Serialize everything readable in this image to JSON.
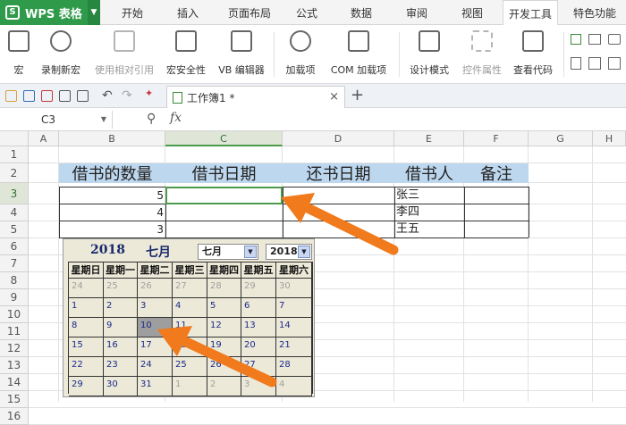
{
  "topbar": {
    "wps_label": "WPS 表格",
    "tabs": [
      "开始",
      "插入",
      "页面布局",
      "公式",
      "数据",
      "审阅",
      "视图",
      "开发工具",
      "特色功能"
    ]
  },
  "ribbon": {
    "buttons": [
      "宏",
      "录制新宏",
      "使用相对引用",
      "宏安全性",
      "VB 编辑器",
      "加载项",
      "COM 加载项",
      "设计模式",
      "控件属性",
      "查看代码"
    ]
  },
  "doc": {
    "tab_label": "工作簿1 *",
    "close": "×",
    "new_tab": "+"
  },
  "formula_bar": {
    "name_box": "C3",
    "fx": "fx"
  },
  "columns": [
    "A",
    "B",
    "C",
    "D",
    "E",
    "F",
    "G",
    "H"
  ],
  "rows": [
    "1",
    "2",
    "3",
    "4",
    "5",
    "6",
    "7",
    "8",
    "9",
    "10",
    "11",
    "12",
    "13",
    "14",
    "15",
    "16"
  ],
  "table": {
    "headers": [
      "借书的数量",
      "借书日期",
      "还书日期",
      "借书人",
      "备注"
    ],
    "quantities": [
      "5",
      "4",
      "3"
    ],
    "borrowers": [
      "张三",
      "李四",
      "王五"
    ]
  },
  "calendar": {
    "year": "2018",
    "month": "七月",
    "month_select": "七月",
    "year_select": "2018",
    "weekdays": [
      "星期日",
      "星期一",
      "星期二",
      "星期三",
      "星期四",
      "星期五",
      "星期六"
    ],
    "weeks": [
      [
        "24",
        "25",
        "26",
        "27",
        "28",
        "29",
        "30"
      ],
      [
        "1",
        "2",
        "3",
        "4",
        "5",
        "6",
        "7"
      ],
      [
        "8",
        "9",
        "10",
        "11",
        "12",
        "13",
        "14"
      ],
      [
        "15",
        "16",
        "17",
        "18",
        "19",
        "20",
        "21"
      ],
      [
        "22",
        "23",
        "24",
        "25",
        "26",
        "27",
        "28"
      ],
      [
        "29",
        "30",
        "31",
        "1",
        "2",
        "3",
        "4"
      ]
    ],
    "other_month_rows": [
      0,
      5
    ],
    "selected_day": "10"
  },
  "colors": {
    "wps_green": "#2e9a4a",
    "header_fill": "#bdd7ee",
    "selection_green": "#4b9a4b",
    "arrow_orange": "#f07a1c",
    "calendar_bg": "#ece9d8"
  }
}
